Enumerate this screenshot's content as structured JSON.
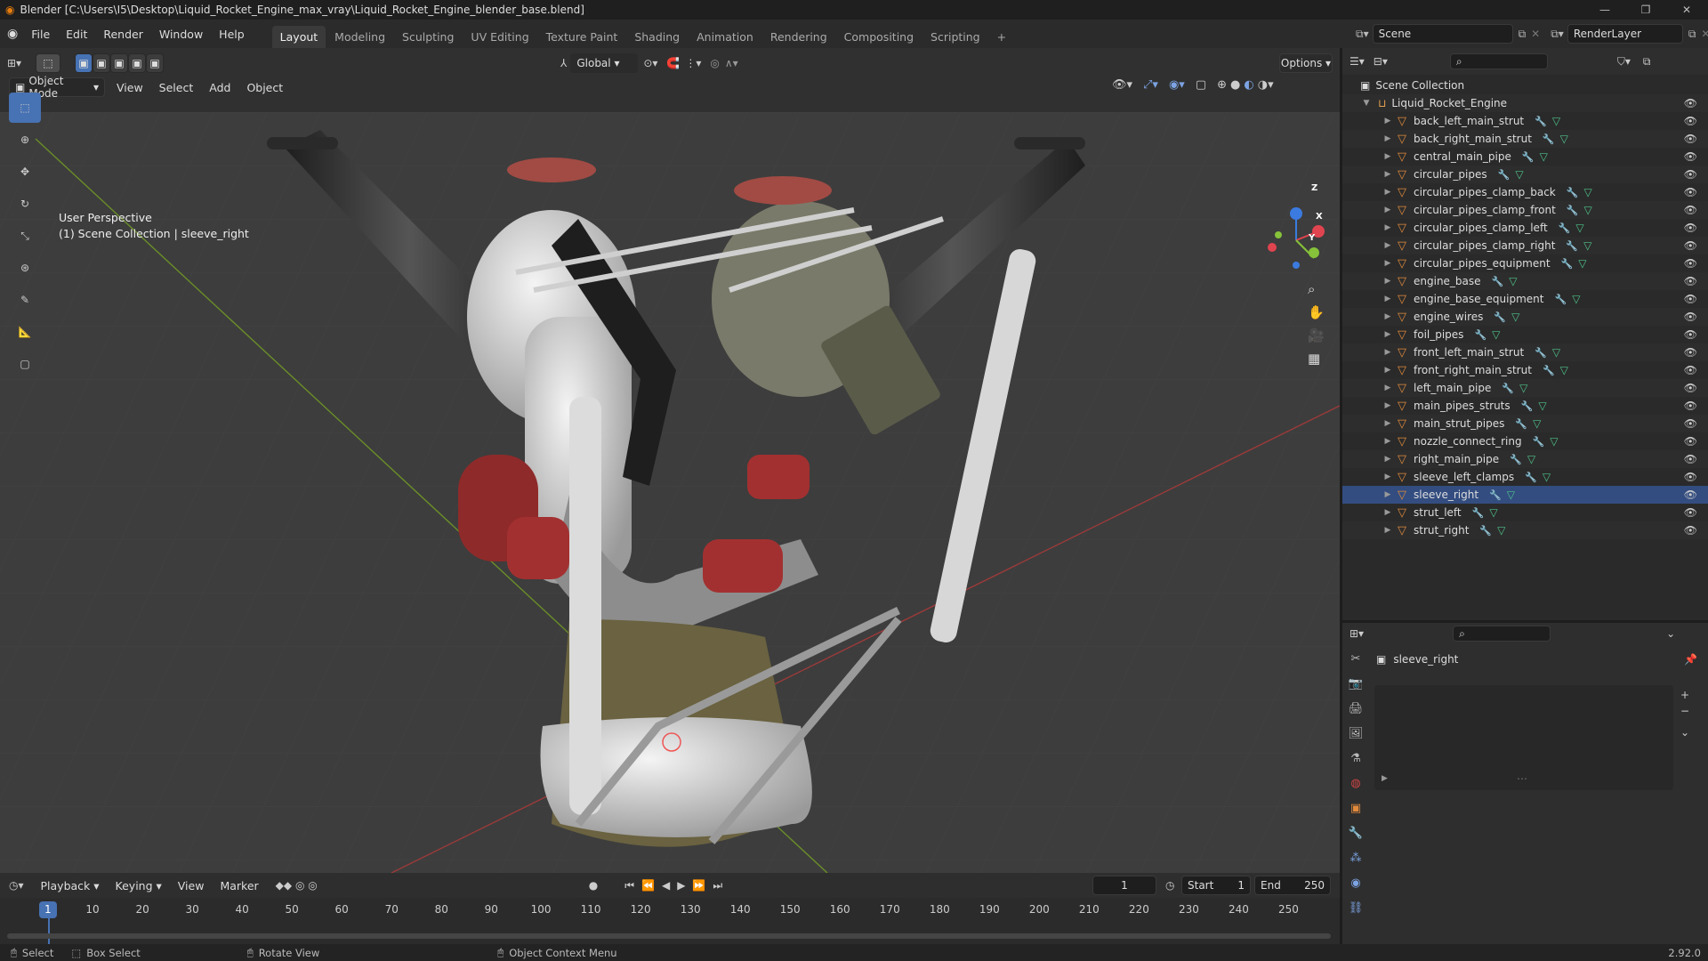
{
  "titlebar": {
    "title": "Blender [C:\\Users\\I5\\Desktop\\Liquid_Rocket_Engine_max_vray\\Liquid_Rocket_Engine_blender_base.blend]"
  },
  "menubar": {
    "menus": [
      "File",
      "Edit",
      "Render",
      "Window",
      "Help"
    ],
    "workspaces": [
      "Layout",
      "Modeling",
      "Sculpting",
      "UV Editing",
      "Texture Paint",
      "Shading",
      "Animation",
      "Rendering",
      "Compositing",
      "Scripting"
    ],
    "active_workspace": "Layout",
    "add_tab": "+",
    "scene": "Scene",
    "view_layer": "RenderLayer"
  },
  "header": {
    "orientation": "Global",
    "options": "Options",
    "mode": "Object Mode",
    "menus": [
      "View",
      "Select",
      "Add",
      "Object"
    ]
  },
  "viewport": {
    "perspective": "User Perspective",
    "collection_info": "(1) Scene Collection | sleeve_right",
    "axes": {
      "x": "X",
      "y": "Y",
      "z": "Z"
    }
  },
  "outliner": {
    "root": "Scene Collection",
    "collection": "Liquid_Rocket_Engine",
    "selected": "sleeve_right",
    "items": [
      "back_left_main_strut",
      "back_right_main_strut",
      "central_main_pipe",
      "circular_pipes",
      "circular_pipes_clamp_back",
      "circular_pipes_clamp_front",
      "circular_pipes_clamp_left",
      "circular_pipes_clamp_right",
      "circular_pipes_equipment",
      "engine_base",
      "engine_base_equipment",
      "engine_wires",
      "foil_pipes",
      "front_left_main_strut",
      "front_right_main_strut",
      "left_main_pipe",
      "main_pipes_struts",
      "main_strut_pipes",
      "nozzle_connect_ring",
      "right_main_pipe",
      "sleeve_left_clamps",
      "sleeve_right",
      "strut_left",
      "strut_right"
    ]
  },
  "properties": {
    "object_name": "sleeve_right"
  },
  "timeline": {
    "menus": [
      "Playback",
      "Keying",
      "View",
      "Marker"
    ],
    "current_frame": "1",
    "start_label": "Start",
    "start": "1",
    "end_label": "End",
    "end": "250",
    "ticks": [
      "1",
      "10",
      "20",
      "30",
      "40",
      "50",
      "60",
      "70",
      "80",
      "90",
      "100",
      "110",
      "120",
      "130",
      "140",
      "150",
      "160",
      "170",
      "180",
      "190",
      "200",
      "210",
      "220",
      "230",
      "240",
      "250"
    ]
  },
  "statusbar": {
    "select": "Select",
    "box_select": "Box Select",
    "rotate": "Rotate View",
    "context": "Object Context Menu",
    "version": "2.92.0"
  },
  "colors": {
    "accent": "#4772b3",
    "mesh": "#e08a3c",
    "modifier": "#7ca3e3",
    "data": "#4ec28a"
  }
}
